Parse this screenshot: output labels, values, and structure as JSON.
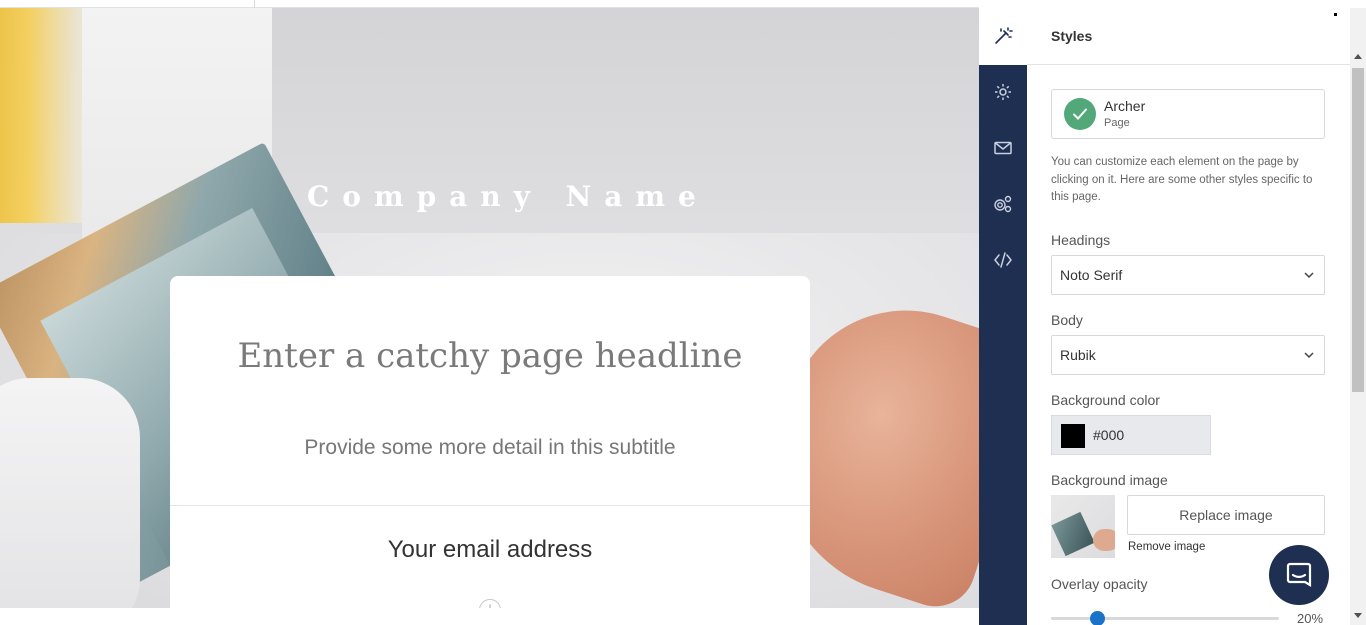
{
  "canvas": {
    "company_name": "Company Name",
    "headline": "Enter a catchy page headline",
    "subtitle": "Provide some more detail in this subtitle",
    "email_placeholder": "Your email address",
    "add_symbol": "+"
  },
  "nav": {
    "icons": [
      "magic-wand-icon",
      "gear-icon",
      "envelope-icon",
      "integrations-icon",
      "code-icon"
    ],
    "active": "magic-wand-icon"
  },
  "panel": {
    "title": "Styles",
    "style_card": {
      "name": "Archer",
      "type": "Page"
    },
    "description": "You can customize each element on the page by clicking on it. Here are some other styles specific to this page.",
    "headings": {
      "label": "Headings",
      "value": "Noto Serif"
    },
    "body": {
      "label": "Body",
      "value": "Rubik"
    },
    "background_color": {
      "label": "Background color",
      "value": "#000"
    },
    "background_image": {
      "label": "Background image",
      "replace_label": "Replace image",
      "remove_label": "Remove image"
    },
    "overlay_opacity": {
      "label": "Overlay opacity",
      "value_text": "20%",
      "value": 0.2
    }
  },
  "colors": {
    "nav_bg": "#1e2f52",
    "accent": "#1a73c8",
    "check_green": "#53a87a",
    "swatch": "#000000"
  },
  "chat": {
    "icon": "chat-icon"
  }
}
